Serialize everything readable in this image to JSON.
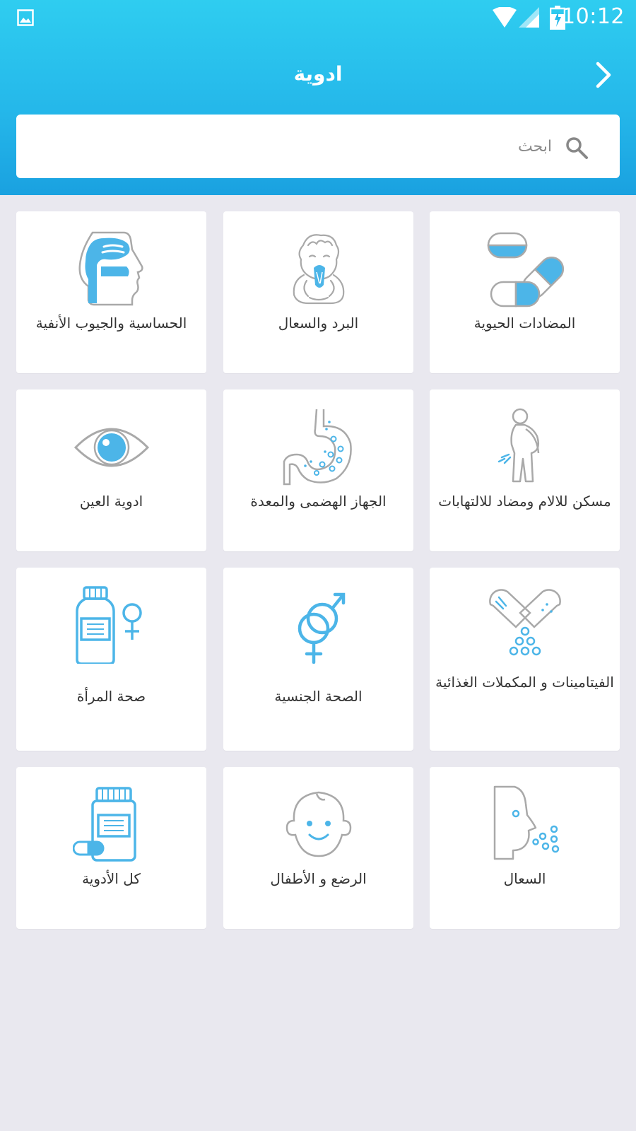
{
  "status_bar": {
    "time": "10:12",
    "icons": [
      "image-icon",
      "wifi-icon",
      "signal-icon",
      "battery-icon"
    ]
  },
  "app_bar": {
    "title": "ادوية",
    "forward_icon": "chevron-right-icon"
  },
  "search": {
    "placeholder": "ابحث",
    "icon": "search-icon"
  },
  "colors": {
    "header_top": "#2fcdf0",
    "header_bottom": "#1aa1e0",
    "accent_blue": "#4cb5e8",
    "icon_gray": "#a9a9a9",
    "background": "#e9e8ef",
    "card": "#ffffff",
    "text": "#333333"
  },
  "categories": [
    {
      "label": "المضادات الحيوية",
      "icon": "capsules-icon"
    },
    {
      "label": "البرد والسعال",
      "icon": "sneezing-child-icon"
    },
    {
      "label": "الحساسية والجيوب الأنفية",
      "icon": "nasal-sinus-icon"
    },
    {
      "label": "مسكن للالام ومضاد للالتهابات",
      "icon": "back-pain-icon"
    },
    {
      "label": "الجهاز الهضمى والمعدة",
      "icon": "stomach-icon"
    },
    {
      "label": "ادوية العين",
      "icon": "eye-icon"
    },
    {
      "label": "الفيتامينات و المكملات الغذائية",
      "icon": "vitamin-capsules-icon"
    },
    {
      "label": "الصحة الجنسية",
      "icon": "gender-symbols-icon"
    },
    {
      "label": "صحة المرأة",
      "icon": "female-bottle-icon"
    },
    {
      "label": "السعال",
      "icon": "coughing-face-icon"
    },
    {
      "label": "الرضع و الأطفال",
      "icon": "baby-face-icon"
    },
    {
      "label": "كل الأدوية",
      "icon": "pill-bottle-icon"
    }
  ]
}
